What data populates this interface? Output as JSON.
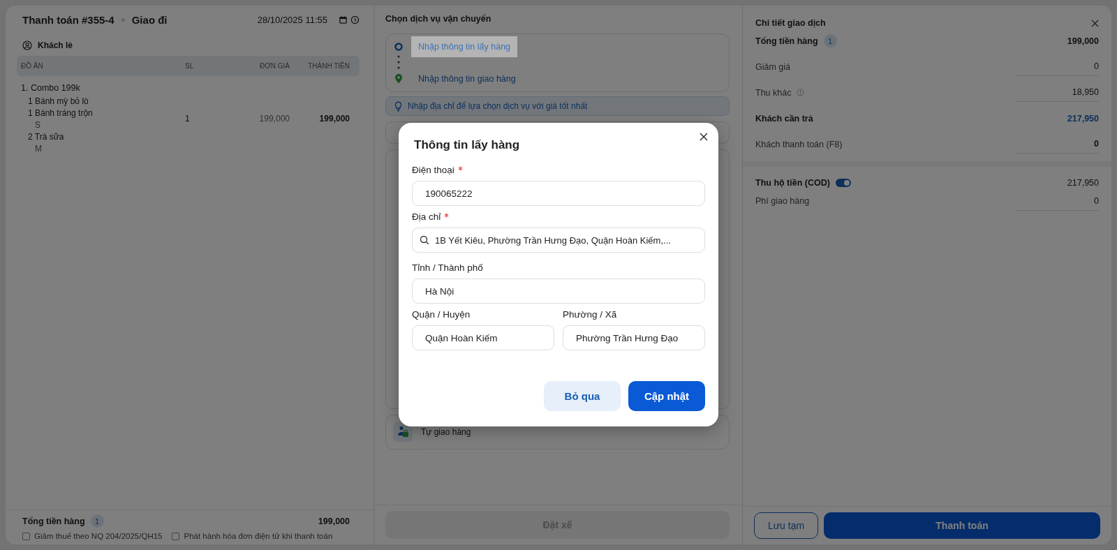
{
  "order": {
    "title": "Thanh toán #355-4",
    "mode": "Giao đi",
    "datetime": "28/10/2025 11:55",
    "customer": "Khách lẻ",
    "columns": [
      "ĐỒ ĂN",
      "SL",
      "ĐƠN GIÁ",
      "THÀNH TIỀN"
    ],
    "rows": [
      {
        "name": "1. Combo 199k",
        "parts": [
          {
            "text": "1 Bánh mỳ bỏ lò"
          },
          {
            "text": "1 Bánh tráng trộn",
            "option": "S"
          },
          {
            "text": "2 Trà sữa",
            "option": "M"
          }
        ],
        "qty": "1",
        "price": "199,000",
        "total": "199,000"
      }
    ],
    "footer": {
      "label": "Tổng tiền hàng",
      "count": "1",
      "total": "199,000"
    },
    "checkboxes": [
      {
        "label": "Giảm thuế theo NQ 204/2025/QH15",
        "checked": false
      },
      {
        "label": "Phát hành hóa đơn điện tử khi thanh toán",
        "checked": false
      }
    ]
  },
  "shipping": {
    "title": "Chọn dịch vụ vận chuyển",
    "pickup": {
      "label": "Nhập thông tin lấy hàng",
      "highlighted": true
    },
    "delivery": {
      "label": "Nhập thông tin giao hàng"
    },
    "tip": "Nhập địa chỉ để lựa chọn dịch vụ với giá tốt nhất",
    "self_delivery": "Tự giao hàng",
    "book_button": {
      "label": "Đặt xế",
      "disabled": true
    }
  },
  "summary": {
    "title": "Chi tiết giao dịch",
    "count": "1",
    "rows": [
      {
        "label": "Tổng tiền hàng",
        "value": "199,000",
        "kind": "total"
      },
      {
        "label": "Giảm giá",
        "value": "0",
        "kind": "input"
      },
      {
        "label": "Thu khác",
        "value": "18,950",
        "kind": "info"
      },
      {
        "label": "Khách cần trả",
        "value": "217,950",
        "kind": "due"
      },
      {
        "label": "Khách thanh toán (F8)",
        "value": "0",
        "kind": "paid"
      }
    ],
    "cod": {
      "label": "Thu hộ tiền (COD)",
      "on": true,
      "value": "217,950"
    },
    "fee": {
      "label": "Phí giao hàng",
      "value": "0"
    },
    "buttons": [
      {
        "label": "Lưu tạm",
        "kind": "secondary"
      },
      {
        "label": "Thanh toán",
        "kind": "primary"
      }
    ]
  },
  "modal": {
    "title": "Thông tin lấy hàng",
    "fields": [
      {
        "label": "Điện thoại",
        "required": true,
        "value": "190065222",
        "kind": "text"
      },
      {
        "label": "Địa chỉ",
        "required": true,
        "value": "1B Yết Kiêu, Phường Trần Hưng Đạo, Quận Hoàn Kiếm,...",
        "kind": "search"
      },
      {
        "label": "Tỉnh / Thành phố",
        "required": false,
        "value": "Hà Nội",
        "kind": "text"
      }
    ],
    "pair": [
      {
        "label": "Quận / Huyện",
        "value": "Quận Hoàn Kiếm"
      },
      {
        "label": "Phường / Xã",
        "value": "Phường Trần Hưng Đạo"
      }
    ],
    "buttons": [
      {
        "label": "Bỏ qua",
        "kind": "secondary"
      },
      {
        "label": "Cập nhật",
        "kind": "primary"
      }
    ]
  }
}
